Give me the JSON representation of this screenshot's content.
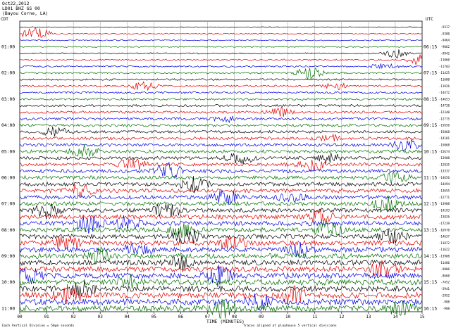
{
  "header": {
    "date_line": "Oct22,2012",
    "station_line": "LD01 BHZ GS 00",
    "location_line": "(Bayou Corne, LA)"
  },
  "left_axis": {
    "timezone": "CDT",
    "labels": [
      "01:00",
      "02:00",
      "03:00",
      "04:00",
      "05:00",
      "06:00",
      "07:00",
      "08:00",
      "09:00",
      "10:00",
      "11:00"
    ]
  },
  "right_axis": {
    "timezone": "UTC",
    "labels": [
      "06:15",
      "07:15",
      "08:15",
      "09:15",
      "10:15",
      "11:15",
      "12:15",
      "13:15",
      "14:15",
      "15:15",
      "16:15"
    ]
  },
  "x_axis": {
    "title": "TIME (MINUTES)",
    "ticks": [
      "00",
      "01",
      "02",
      "03",
      "04",
      "05",
      "06",
      "07",
      "08",
      "09",
      "10",
      "11",
      "12",
      "13",
      "14",
      "15"
    ]
  },
  "footer": {
    "left": "Each Vertical Division = 50µm seconds",
    "center": "Traces aligned at playhouse 5 vertical divisions"
  },
  "colors": {
    "trace_cycle": [
      "#000000",
      "#e00000",
      "#0000e0",
      "#007000"
    ],
    "grid": "#9a9a9a",
    "frame": "#000000",
    "background": "#ffffff"
  },
  "chart_data": {
    "type": "line",
    "description_type": "helicorder",
    "x_range_minutes": [
      0,
      15
    ],
    "rows_per_hour": 4,
    "row_count": 44,
    "row_color_cycle": [
      "black",
      "red",
      "blue",
      "green"
    ],
    "right_mean_counts": [
      "-9317",
      "-9380",
      "-9464",
      "-9862",
      "-9942",
      "-11060",
      "-11703",
      "-11425",
      "-11600",
      "-11926",
      "-14472",
      "-14653",
      "-14720",
      "-12340",
      "-12775",
      "-15656",
      "-15868",
      "-14181",
      "-15068",
      "-15674",
      "-13908",
      "-12835",
      "-13337",
      "-14656",
      "-14494",
      "-13655",
      "-12771",
      "-13908",
      "-14193",
      "-13826",
      "-17239",
      "-16970",
      "-14637",
      "-11872",
      "-11622",
      "-13908",
      "-11486",
      "-9806",
      "-8660",
      "-7452",
      "-5941",
      "-2952",
      "-908",
      "-908"
    ],
    "grid": true,
    "legend": "none"
  }
}
